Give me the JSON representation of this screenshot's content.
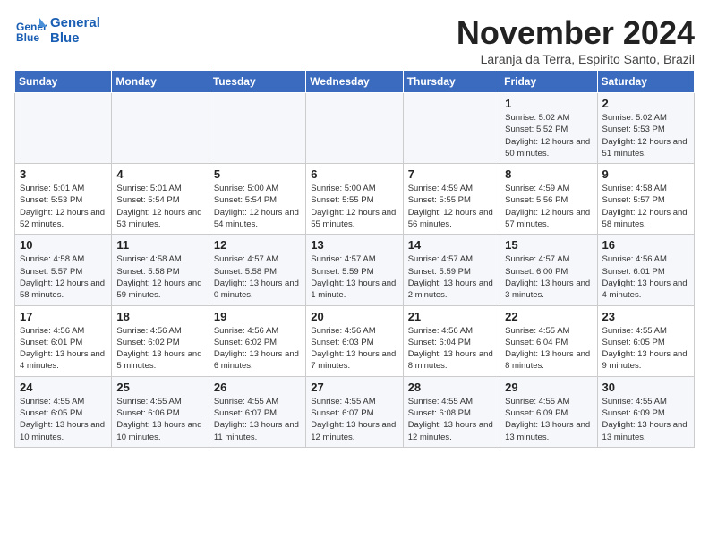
{
  "logo": {
    "line1": "General",
    "line2": "Blue"
  },
  "title": "November 2024",
  "subtitle": "Laranja da Terra, Espirito Santo, Brazil",
  "days_of_week": [
    "Sunday",
    "Monday",
    "Tuesday",
    "Wednesday",
    "Thursday",
    "Friday",
    "Saturday"
  ],
  "weeks": [
    [
      {
        "day": "",
        "info": ""
      },
      {
        "day": "",
        "info": ""
      },
      {
        "day": "",
        "info": ""
      },
      {
        "day": "",
        "info": ""
      },
      {
        "day": "",
        "info": ""
      },
      {
        "day": "1",
        "info": "Sunrise: 5:02 AM\nSunset: 5:52 PM\nDaylight: 12 hours and 50 minutes."
      },
      {
        "day": "2",
        "info": "Sunrise: 5:02 AM\nSunset: 5:53 PM\nDaylight: 12 hours and 51 minutes."
      }
    ],
    [
      {
        "day": "3",
        "info": "Sunrise: 5:01 AM\nSunset: 5:53 PM\nDaylight: 12 hours and 52 minutes."
      },
      {
        "day": "4",
        "info": "Sunrise: 5:01 AM\nSunset: 5:54 PM\nDaylight: 12 hours and 53 minutes."
      },
      {
        "day": "5",
        "info": "Sunrise: 5:00 AM\nSunset: 5:54 PM\nDaylight: 12 hours and 54 minutes."
      },
      {
        "day": "6",
        "info": "Sunrise: 5:00 AM\nSunset: 5:55 PM\nDaylight: 12 hours and 55 minutes."
      },
      {
        "day": "7",
        "info": "Sunrise: 4:59 AM\nSunset: 5:55 PM\nDaylight: 12 hours and 56 minutes."
      },
      {
        "day": "8",
        "info": "Sunrise: 4:59 AM\nSunset: 5:56 PM\nDaylight: 12 hours and 57 minutes."
      },
      {
        "day": "9",
        "info": "Sunrise: 4:58 AM\nSunset: 5:57 PM\nDaylight: 12 hours and 58 minutes."
      }
    ],
    [
      {
        "day": "10",
        "info": "Sunrise: 4:58 AM\nSunset: 5:57 PM\nDaylight: 12 hours and 58 minutes."
      },
      {
        "day": "11",
        "info": "Sunrise: 4:58 AM\nSunset: 5:58 PM\nDaylight: 12 hours and 59 minutes."
      },
      {
        "day": "12",
        "info": "Sunrise: 4:57 AM\nSunset: 5:58 PM\nDaylight: 13 hours and 0 minutes."
      },
      {
        "day": "13",
        "info": "Sunrise: 4:57 AM\nSunset: 5:59 PM\nDaylight: 13 hours and 1 minute."
      },
      {
        "day": "14",
        "info": "Sunrise: 4:57 AM\nSunset: 5:59 PM\nDaylight: 13 hours and 2 minutes."
      },
      {
        "day": "15",
        "info": "Sunrise: 4:57 AM\nSunset: 6:00 PM\nDaylight: 13 hours and 3 minutes."
      },
      {
        "day": "16",
        "info": "Sunrise: 4:56 AM\nSunset: 6:01 PM\nDaylight: 13 hours and 4 minutes."
      }
    ],
    [
      {
        "day": "17",
        "info": "Sunrise: 4:56 AM\nSunset: 6:01 PM\nDaylight: 13 hours and 4 minutes."
      },
      {
        "day": "18",
        "info": "Sunrise: 4:56 AM\nSunset: 6:02 PM\nDaylight: 13 hours and 5 minutes."
      },
      {
        "day": "19",
        "info": "Sunrise: 4:56 AM\nSunset: 6:02 PM\nDaylight: 13 hours and 6 minutes."
      },
      {
        "day": "20",
        "info": "Sunrise: 4:56 AM\nSunset: 6:03 PM\nDaylight: 13 hours and 7 minutes."
      },
      {
        "day": "21",
        "info": "Sunrise: 4:56 AM\nSunset: 6:04 PM\nDaylight: 13 hours and 8 minutes."
      },
      {
        "day": "22",
        "info": "Sunrise: 4:55 AM\nSunset: 6:04 PM\nDaylight: 13 hours and 8 minutes."
      },
      {
        "day": "23",
        "info": "Sunrise: 4:55 AM\nSunset: 6:05 PM\nDaylight: 13 hours and 9 minutes."
      }
    ],
    [
      {
        "day": "24",
        "info": "Sunrise: 4:55 AM\nSunset: 6:05 PM\nDaylight: 13 hours and 10 minutes."
      },
      {
        "day": "25",
        "info": "Sunrise: 4:55 AM\nSunset: 6:06 PM\nDaylight: 13 hours and 10 minutes."
      },
      {
        "day": "26",
        "info": "Sunrise: 4:55 AM\nSunset: 6:07 PM\nDaylight: 13 hours and 11 minutes."
      },
      {
        "day": "27",
        "info": "Sunrise: 4:55 AM\nSunset: 6:07 PM\nDaylight: 13 hours and 12 minutes."
      },
      {
        "day": "28",
        "info": "Sunrise: 4:55 AM\nSunset: 6:08 PM\nDaylight: 13 hours and 12 minutes."
      },
      {
        "day": "29",
        "info": "Sunrise: 4:55 AM\nSunset: 6:09 PM\nDaylight: 13 hours and 13 minutes."
      },
      {
        "day": "30",
        "info": "Sunrise: 4:55 AM\nSunset: 6:09 PM\nDaylight: 13 hours and 13 minutes."
      }
    ]
  ]
}
